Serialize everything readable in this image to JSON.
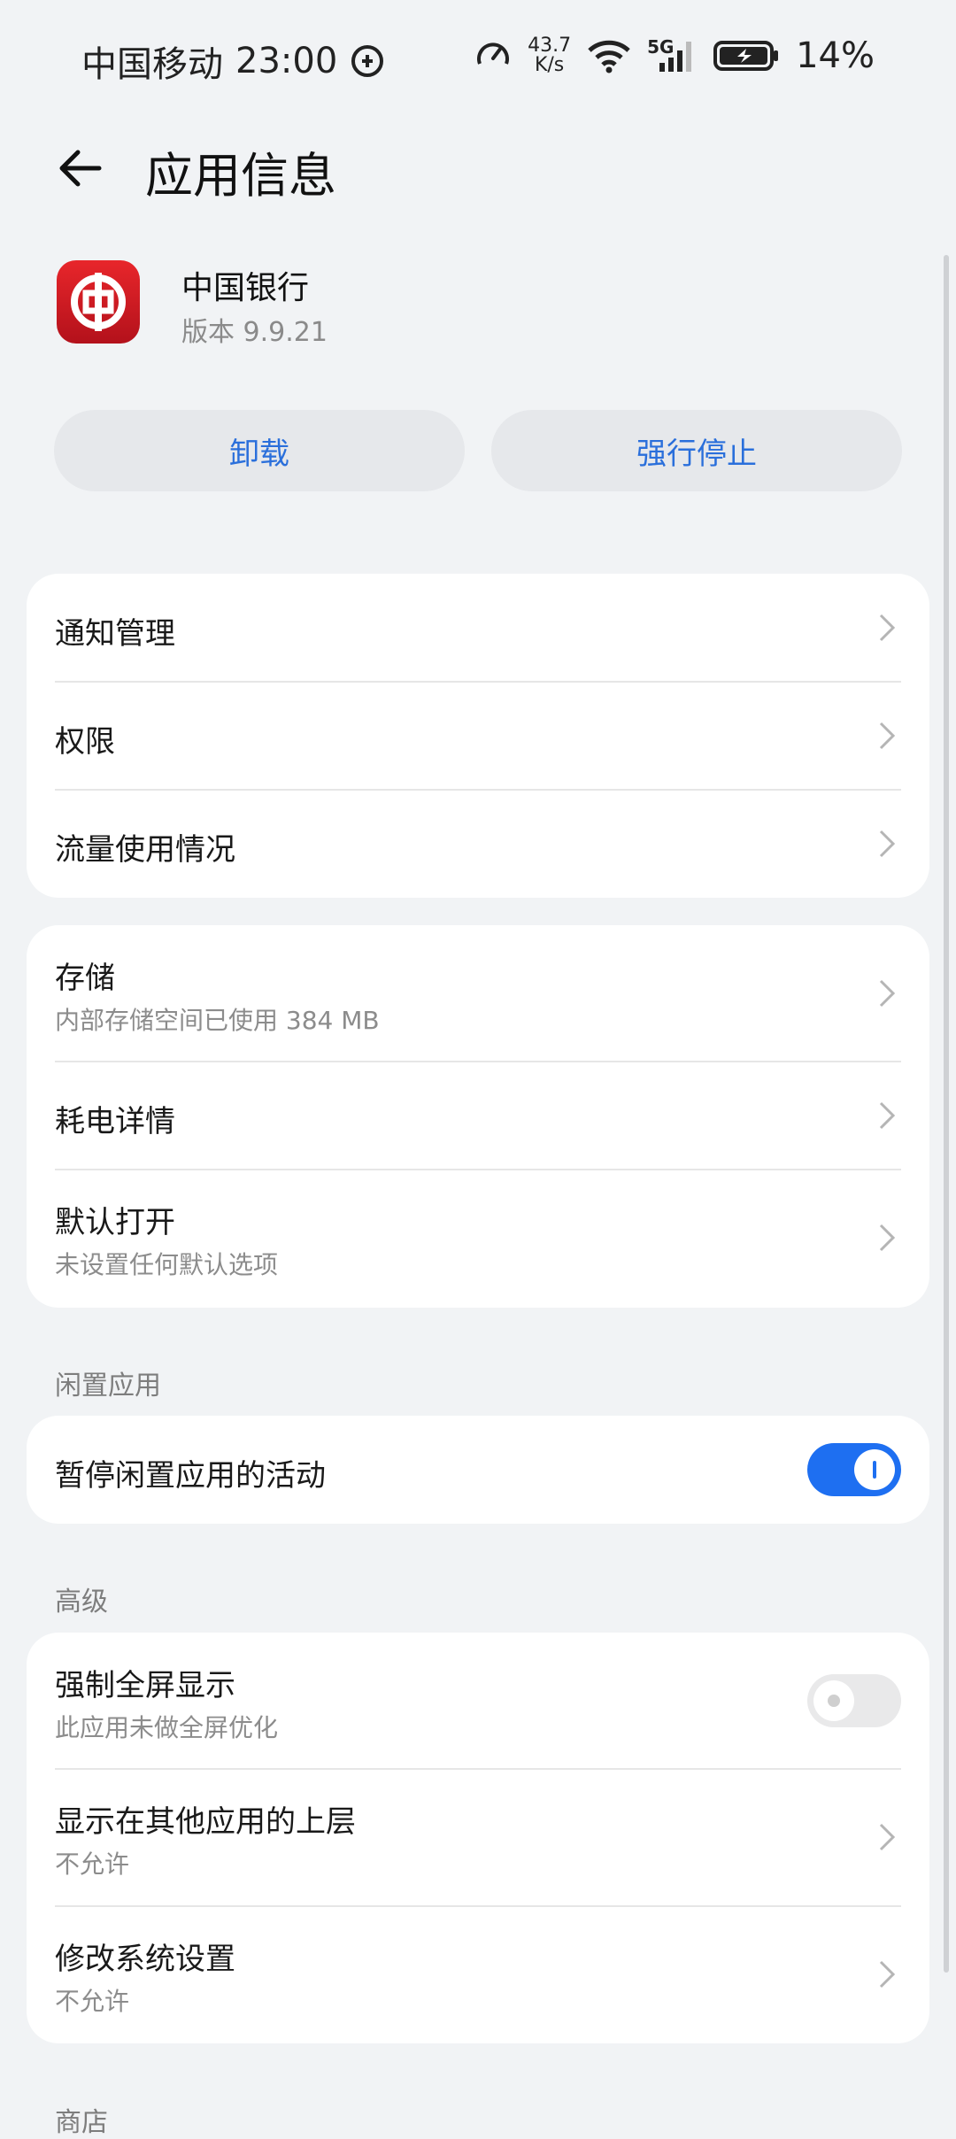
{
  "status_bar": {
    "carrier": "中国移动",
    "time": "23:00",
    "net_speed_value": "43.7",
    "net_speed_unit": "K/s",
    "network": "5G",
    "battery": "14%"
  },
  "header": {
    "title": "应用信息"
  },
  "app": {
    "name": "中国银行",
    "version": "版本 9.9.21"
  },
  "actions": {
    "uninstall": "卸载",
    "force_stop": "强行停止"
  },
  "group1": {
    "items": [
      {
        "title": "通知管理"
      },
      {
        "title": "权限"
      },
      {
        "title": "流量使用情况"
      }
    ]
  },
  "group2": {
    "items": [
      {
        "title": "存储",
        "subtitle": "内部存储空间已使用 384 MB"
      },
      {
        "title": "耗电详情"
      },
      {
        "title": "默认打开",
        "subtitle": "未设置任何默认选项"
      }
    ]
  },
  "idle": {
    "section": "闲置应用",
    "item": {
      "title": "暂停闲置应用的活动",
      "enabled": true
    }
  },
  "advanced": {
    "section": "高级",
    "items": [
      {
        "title": "强制全屏显示",
        "subtitle": "此应用未做全屏优化",
        "enabled": false
      },
      {
        "title": "显示在其他应用的上层",
        "subtitle": "不允许"
      },
      {
        "title": "修改系统设置",
        "subtitle": "不允许"
      }
    ]
  },
  "store": {
    "section": "商店"
  },
  "colors": {
    "accent": "#1e6ff1",
    "link": "#2a6fdb",
    "background": "#f1f3f5"
  }
}
